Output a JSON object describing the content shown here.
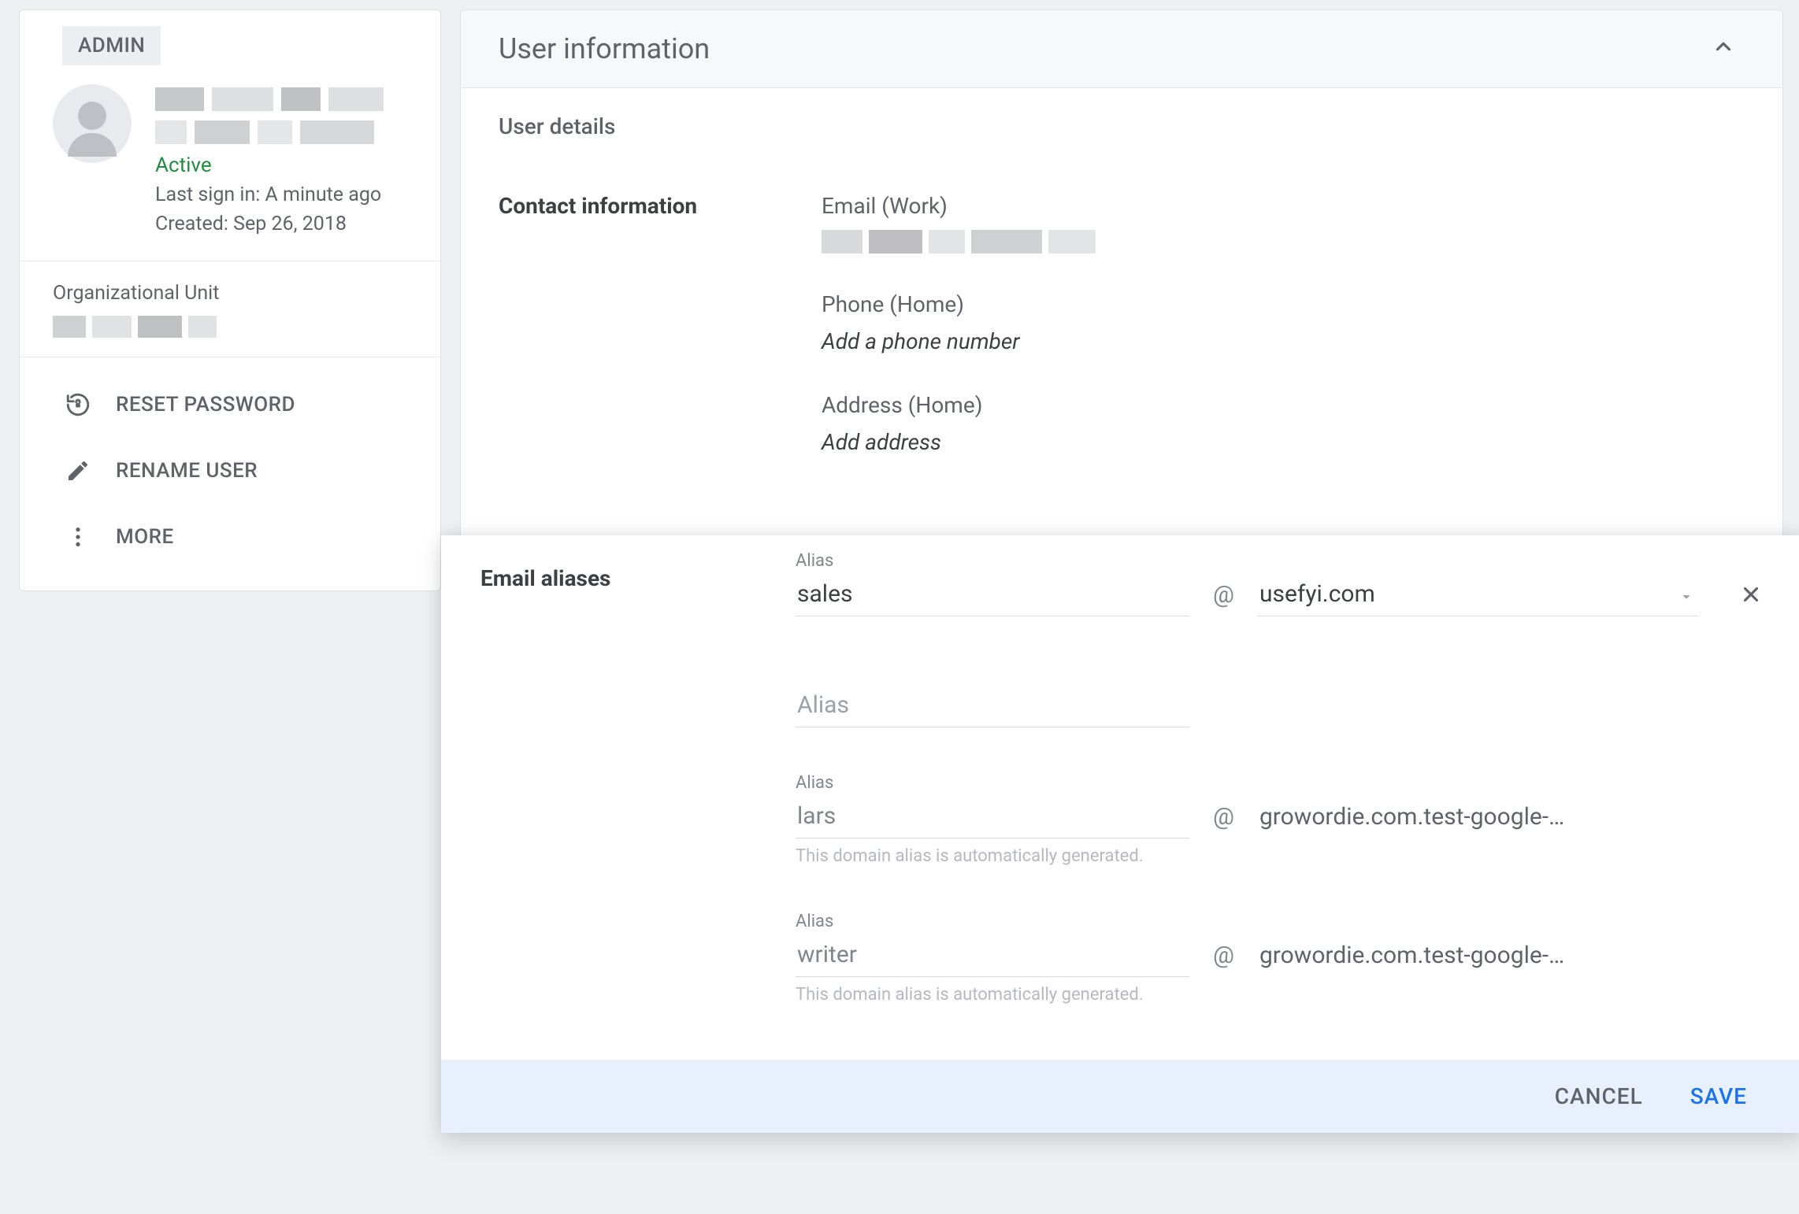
{
  "sidebar": {
    "admin_badge": "ADMIN",
    "status": "Active",
    "last_sign_in": "Last sign in: A minute ago",
    "created": "Created: Sep 26, 2018",
    "org_unit_label": "Organizational Unit",
    "actions": {
      "reset_password": "RESET PASSWORD",
      "rename_user": "RENAME USER",
      "more": "MORE"
    }
  },
  "panel": {
    "title": "User information",
    "user_details_label": "User details",
    "contact_heading": "Contact information",
    "email_label": "Email (Work)",
    "phone_label": "Phone (Home)",
    "phone_placeholder": "Add a phone number",
    "address_label": "Address (Home)",
    "address_placeholder": "Add address"
  },
  "dialog": {
    "title": "Email aliases",
    "alias_field_label": "Alias",
    "alias_input_placeholder": "Alias",
    "auto_gen_note": "This domain alias is automatically generated.",
    "aliases": [
      {
        "value": "sales",
        "domain": "usefyi.com",
        "editable_domain": true,
        "removable": true,
        "autogen": false
      },
      {
        "value": "",
        "domain": "",
        "editable_domain": false,
        "removable": false,
        "autogen": false,
        "placeholder_only": true
      },
      {
        "value": "lars",
        "domain": "growordie.com.test-google-…",
        "editable_domain": false,
        "removable": false,
        "autogen": true
      },
      {
        "value": "writer",
        "domain": "growordie.com.test-google-…",
        "editable_domain": false,
        "removable": false,
        "autogen": true
      }
    ],
    "cancel_label": "CANCEL",
    "save_label": "SAVE",
    "at_symbol": "@"
  }
}
